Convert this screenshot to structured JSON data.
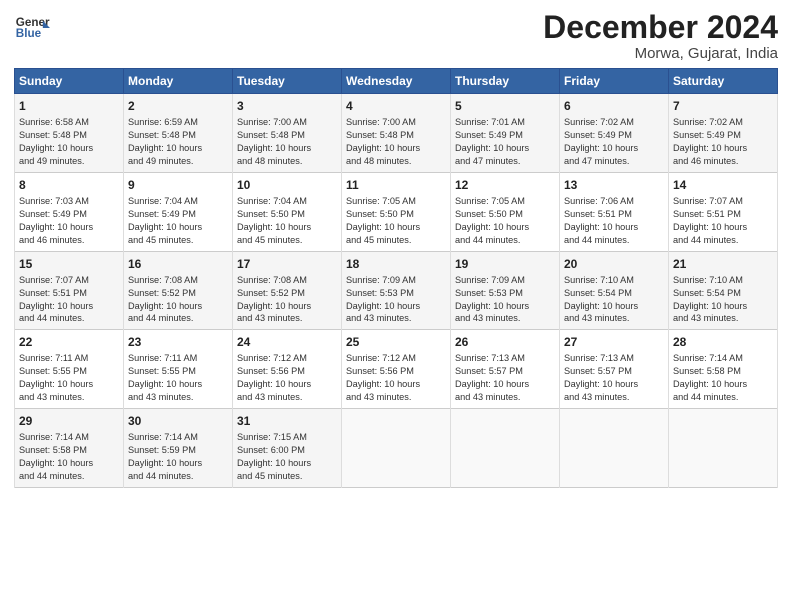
{
  "header": {
    "logo_line1": "General",
    "logo_line2": "Blue",
    "title": "December 2024",
    "subtitle": "Morwa, Gujarat, India"
  },
  "days_of_week": [
    "Sunday",
    "Monday",
    "Tuesday",
    "Wednesday",
    "Thursday",
    "Friday",
    "Saturday"
  ],
  "weeks": [
    [
      {
        "day": "1",
        "info": "Sunrise: 6:58 AM\nSunset: 5:48 PM\nDaylight: 10 hours\nand 49 minutes."
      },
      {
        "day": "2",
        "info": "Sunrise: 6:59 AM\nSunset: 5:48 PM\nDaylight: 10 hours\nand 49 minutes."
      },
      {
        "day": "3",
        "info": "Sunrise: 7:00 AM\nSunset: 5:48 PM\nDaylight: 10 hours\nand 48 minutes."
      },
      {
        "day": "4",
        "info": "Sunrise: 7:00 AM\nSunset: 5:48 PM\nDaylight: 10 hours\nand 48 minutes."
      },
      {
        "day": "5",
        "info": "Sunrise: 7:01 AM\nSunset: 5:49 PM\nDaylight: 10 hours\nand 47 minutes."
      },
      {
        "day": "6",
        "info": "Sunrise: 7:02 AM\nSunset: 5:49 PM\nDaylight: 10 hours\nand 47 minutes."
      },
      {
        "day": "7",
        "info": "Sunrise: 7:02 AM\nSunset: 5:49 PM\nDaylight: 10 hours\nand 46 minutes."
      }
    ],
    [
      {
        "day": "8",
        "info": "Sunrise: 7:03 AM\nSunset: 5:49 PM\nDaylight: 10 hours\nand 46 minutes."
      },
      {
        "day": "9",
        "info": "Sunrise: 7:04 AM\nSunset: 5:49 PM\nDaylight: 10 hours\nand 45 minutes."
      },
      {
        "day": "10",
        "info": "Sunrise: 7:04 AM\nSunset: 5:50 PM\nDaylight: 10 hours\nand 45 minutes."
      },
      {
        "day": "11",
        "info": "Sunrise: 7:05 AM\nSunset: 5:50 PM\nDaylight: 10 hours\nand 45 minutes."
      },
      {
        "day": "12",
        "info": "Sunrise: 7:05 AM\nSunset: 5:50 PM\nDaylight: 10 hours\nand 44 minutes."
      },
      {
        "day": "13",
        "info": "Sunrise: 7:06 AM\nSunset: 5:51 PM\nDaylight: 10 hours\nand 44 minutes."
      },
      {
        "day": "14",
        "info": "Sunrise: 7:07 AM\nSunset: 5:51 PM\nDaylight: 10 hours\nand 44 minutes."
      }
    ],
    [
      {
        "day": "15",
        "info": "Sunrise: 7:07 AM\nSunset: 5:51 PM\nDaylight: 10 hours\nand 44 minutes."
      },
      {
        "day": "16",
        "info": "Sunrise: 7:08 AM\nSunset: 5:52 PM\nDaylight: 10 hours\nand 44 minutes."
      },
      {
        "day": "17",
        "info": "Sunrise: 7:08 AM\nSunset: 5:52 PM\nDaylight: 10 hours\nand 43 minutes."
      },
      {
        "day": "18",
        "info": "Sunrise: 7:09 AM\nSunset: 5:53 PM\nDaylight: 10 hours\nand 43 minutes."
      },
      {
        "day": "19",
        "info": "Sunrise: 7:09 AM\nSunset: 5:53 PM\nDaylight: 10 hours\nand 43 minutes."
      },
      {
        "day": "20",
        "info": "Sunrise: 7:10 AM\nSunset: 5:54 PM\nDaylight: 10 hours\nand 43 minutes."
      },
      {
        "day": "21",
        "info": "Sunrise: 7:10 AM\nSunset: 5:54 PM\nDaylight: 10 hours\nand 43 minutes."
      }
    ],
    [
      {
        "day": "22",
        "info": "Sunrise: 7:11 AM\nSunset: 5:55 PM\nDaylight: 10 hours\nand 43 minutes."
      },
      {
        "day": "23",
        "info": "Sunrise: 7:11 AM\nSunset: 5:55 PM\nDaylight: 10 hours\nand 43 minutes."
      },
      {
        "day": "24",
        "info": "Sunrise: 7:12 AM\nSunset: 5:56 PM\nDaylight: 10 hours\nand 43 minutes."
      },
      {
        "day": "25",
        "info": "Sunrise: 7:12 AM\nSunset: 5:56 PM\nDaylight: 10 hours\nand 43 minutes."
      },
      {
        "day": "26",
        "info": "Sunrise: 7:13 AM\nSunset: 5:57 PM\nDaylight: 10 hours\nand 43 minutes."
      },
      {
        "day": "27",
        "info": "Sunrise: 7:13 AM\nSunset: 5:57 PM\nDaylight: 10 hours\nand 43 minutes."
      },
      {
        "day": "28",
        "info": "Sunrise: 7:14 AM\nSunset: 5:58 PM\nDaylight: 10 hours\nand 44 minutes."
      }
    ],
    [
      {
        "day": "29",
        "info": "Sunrise: 7:14 AM\nSunset: 5:58 PM\nDaylight: 10 hours\nand 44 minutes."
      },
      {
        "day": "30",
        "info": "Sunrise: 7:14 AM\nSunset: 5:59 PM\nDaylight: 10 hours\nand 44 minutes."
      },
      {
        "day": "31",
        "info": "Sunrise: 7:15 AM\nSunset: 6:00 PM\nDaylight: 10 hours\nand 45 minutes."
      },
      null,
      null,
      null,
      null
    ]
  ]
}
